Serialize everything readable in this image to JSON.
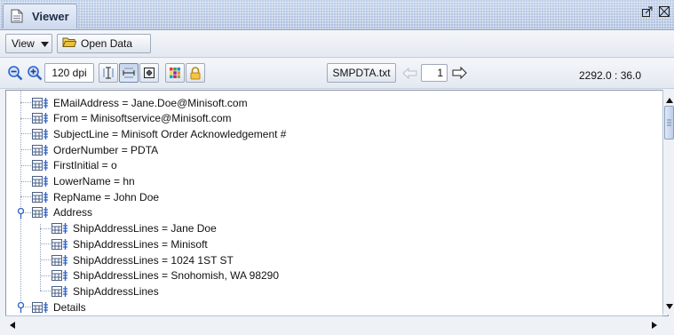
{
  "window": {
    "title": "Viewer",
    "icons": [
      "document-icon",
      "restore-icon",
      "close-icon"
    ]
  },
  "menubar": {
    "view_label": "View",
    "open_data_label": "Open Data"
  },
  "toolbar": {
    "zoom_out_icon": "zoom-out-icon",
    "zoom_in_icon": "zoom-in-icon",
    "dpi_value": "120 dpi",
    "filename": "SMPDTA.txt",
    "page_value": "1",
    "coordinates": "2292.0 : 36.0"
  },
  "tree": {
    "nodes": [
      {
        "label": "EMailAddress = Jane.Doe@Minisoft.com",
        "level": 1
      },
      {
        "label": "From = Minisoftservice@Minisoft.com",
        "level": 1
      },
      {
        "label": "SubjectLine = Minisoft Order Acknowledgement #",
        "level": 1
      },
      {
        "label": "OrderNumber = PDTA",
        "level": 1
      },
      {
        "label": "FirstInitial = o",
        "level": 1
      },
      {
        "label": "LowerName = hn",
        "level": 1
      },
      {
        "label": "RepName = John Doe",
        "level": 1
      },
      {
        "label": "Address",
        "level": 1,
        "expanded": true
      },
      {
        "label": "ShipAddressLines = Jane Doe",
        "level": 2
      },
      {
        "label": "ShipAddressLines = Minisoft",
        "level": 2
      },
      {
        "label": "ShipAddressLines = 1024 1ST ST",
        "level": 2
      },
      {
        "label": "ShipAddressLines = Snohomish, WA 98290",
        "level": 2
      },
      {
        "label": "ShipAddressLines",
        "level": 2
      },
      {
        "label": "Details",
        "level": 1,
        "expanded": true
      }
    ]
  },
  "colors": {
    "titlebar": "#b8c9e6",
    "accent_blue": "#2f63c9",
    "folder_yellow": "#e8c23a"
  }
}
